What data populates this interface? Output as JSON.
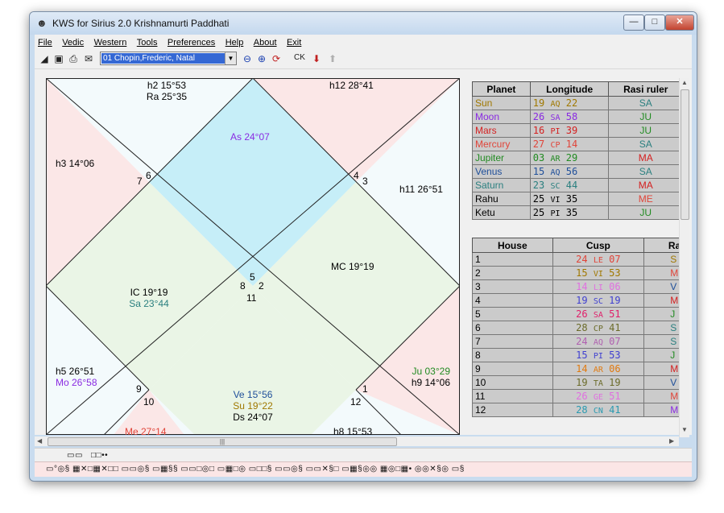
{
  "window": {
    "title": "KWS for Sirius 2.0 Krishnamurti Paddhati",
    "minimize": "—",
    "maximize": "□",
    "close": "✕"
  },
  "menu": [
    "File",
    "Vedic",
    "Western",
    "Tools",
    "Preferences",
    "Help",
    "About",
    "Exit"
  ],
  "toolbar": {
    "chart_select": "01 Chopin,Frederic, Natal",
    "ck_label": "CK"
  },
  "chart": {
    "houses": [
      {
        "lines": [
          "h2 15°53",
          "Ra 25°35"
        ],
        "colors": [
          "#000000",
          "#000000"
        ]
      },
      {
        "lines": [
          "h12 28°41"
        ],
        "colors": [
          "#000000"
        ]
      },
      {
        "lines": [
          "As 24°07"
        ],
        "colors": [
          "#8a2be2"
        ]
      },
      {
        "lines": [
          "h3 14°06"
        ],
        "colors": [
          "#000000"
        ]
      },
      {
        "lines": [
          "h11 26°51"
        ],
        "colors": [
          "#000000"
        ]
      },
      {
        "lines": [
          "IC 19°19",
          "Sa 23°44"
        ],
        "colors": [
          "#000000",
          "#2a7f7f"
        ]
      },
      {
        "lines": [
          "MC 19°19"
        ],
        "colors": [
          "#000000"
        ]
      },
      {
        "lines": [
          "h5 26°51",
          "Mo 26°58"
        ],
        "colors": [
          "#000000",
          "#8a2be2"
        ]
      },
      {
        "lines": [
          "Ju 03°29",
          "h9 14°06"
        ],
        "colors": [
          "#228b22",
          "#000000"
        ]
      },
      {
        "lines": [
          "Ve 15°56",
          "Su 19°22",
          "Ds 24°07"
        ],
        "colors": [
          "#1f4f9a",
          "#a07800",
          "#000000"
        ]
      },
      {
        "lines": [
          "Me 27°14"
        ],
        "colors": [
          "#e0453a"
        ]
      },
      {
        "lines": [
          "h8 15°53"
        ],
        "colors": [
          "#000000"
        ]
      }
    ],
    "numbers": [
      "7",
      "6",
      "4",
      "3",
      "5",
      "8",
      "2",
      "11",
      "9",
      "10",
      "12",
      "1"
    ]
  },
  "planets": {
    "headers": [
      "Planet",
      "Longitude",
      "Rasi ruler"
    ],
    "rows": [
      {
        "planet": "Sun",
        "deg": "19",
        "sign": "AQ",
        "min": "22",
        "ruler": "SA",
        "pc": "#a07800",
        "lc": "#a07800",
        "rc": "#2a7f7f"
      },
      {
        "planet": "Moon",
        "deg": "26",
        "sign": "SA",
        "min": "58",
        "ruler": "JU",
        "pc": "#8a2be2",
        "lc": "#8a2be2",
        "rc": "#228b22"
      },
      {
        "planet": "Mars",
        "deg": "16",
        "sign": "PI",
        "min": "39",
        "ruler": "JU",
        "pc": "#d42020",
        "lc": "#d42020",
        "rc": "#228b22"
      },
      {
        "planet": "Mercury",
        "deg": "27",
        "sign": "CP",
        "min": "14",
        "ruler": "SA",
        "pc": "#e0453a",
        "lc": "#e0453a",
        "rc": "#2a7f7f"
      },
      {
        "planet": "Jupiter",
        "deg": "03",
        "sign": "AR",
        "min": "29",
        "ruler": "MA",
        "pc": "#228b22",
        "lc": "#228b22",
        "rc": "#d42020"
      },
      {
        "planet": "Venus",
        "deg": "15",
        "sign": "AQ",
        "min": "56",
        "ruler": "SA",
        "pc": "#1f4f9a",
        "lc": "#1f4f9a",
        "rc": "#2a7f7f"
      },
      {
        "planet": "Saturn",
        "deg": "23",
        "sign": "SC",
        "min": "44",
        "ruler": "MA",
        "pc": "#2a7f7f",
        "lc": "#2a7f7f",
        "rc": "#d42020"
      },
      {
        "planet": "Rahu",
        "deg": "25",
        "sign": "VI",
        "min": "35",
        "ruler": "ME",
        "pc": "#000000",
        "lc": "#000000",
        "rc": "#e0453a"
      },
      {
        "planet": "Ketu",
        "deg": "25",
        "sign": "PI",
        "min": "35",
        "ruler": "JU",
        "pc": "#000000",
        "lc": "#000000",
        "rc": "#228b22"
      }
    ]
  },
  "houses": {
    "headers": [
      "House",
      "Cusp",
      "Ra"
    ],
    "rows": [
      {
        "house": "1",
        "deg": "24",
        "sign": "LE",
        "min": "07",
        "ruler": "S",
        "cc": "#e0453a",
        "rc": "#a07800"
      },
      {
        "house": "2",
        "deg": "15",
        "sign": "VI",
        "min": "53",
        "ruler": "M",
        "cc": "#a07800",
        "rc": "#e0453a"
      },
      {
        "house": "3",
        "deg": "14",
        "sign": "LI",
        "min": "06",
        "ruler": "V",
        "cc": "#e070e0",
        "rc": "#1f4f9a"
      },
      {
        "house": "4",
        "deg": "19",
        "sign": "SC",
        "min": "19",
        "ruler": "M",
        "cc": "#4040d0",
        "rc": "#d42020"
      },
      {
        "house": "5",
        "deg": "26",
        "sign": "SA",
        "min": "51",
        "ruler": "J",
        "cc": "#e0206a",
        "rc": "#228b22"
      },
      {
        "house": "6",
        "deg": "28",
        "sign": "CP",
        "min": "41",
        "ruler": "S",
        "cc": "#6b6b2a",
        "rc": "#2a7f7f"
      },
      {
        "house": "7",
        "deg": "24",
        "sign": "AQ",
        "min": "07",
        "ruler": "S",
        "cc": "#b060b0",
        "rc": "#2a7f7f"
      },
      {
        "house": "8",
        "deg": "15",
        "sign": "PI",
        "min": "53",
        "ruler": "J",
        "cc": "#4040d0",
        "rc": "#228b22"
      },
      {
        "house": "9",
        "deg": "14",
        "sign": "AR",
        "min": "06",
        "ruler": "M",
        "cc": "#e07a10",
        "rc": "#d42020"
      },
      {
        "house": "10",
        "deg": "19",
        "sign": "TA",
        "min": "19",
        "ruler": "V",
        "cc": "#6b6b2a",
        "rc": "#1f4f9a"
      },
      {
        "house": "11",
        "deg": "26",
        "sign": "GE",
        "min": "51",
        "ruler": "M",
        "cc": "#e070e0",
        "rc": "#e0453a"
      },
      {
        "house": "12",
        "deg": "28",
        "sign": "CN",
        "min": "41",
        "ruler": "M",
        "cc": "#2a9ab0",
        "rc": "#8a2be2"
      }
    ]
  },
  "status": {
    "line1_a": "▭▭",
    "line1_b": "□□••",
    "line2": "▭°◎§  ▦✕□▦✕□□   ▭▭◎§  ▭▦§§  ▭▭□◎□  ▭▦□◎  ▭□□§  ▭▭◎§  ▭▭✕§□  ▭▦§◎◎  ▦◎□▦•  ◎◎✕§◎  ▭§"
  }
}
